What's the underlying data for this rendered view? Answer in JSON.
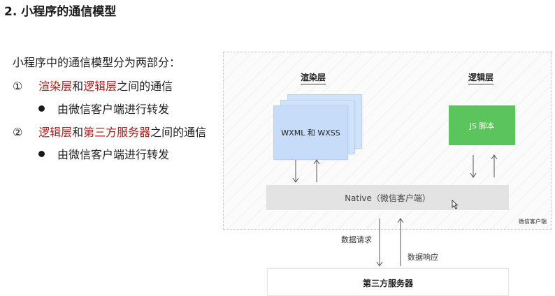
{
  "heading": "2. 小程序的通信模型",
  "intro": "小程序中的通信模型分为两部分：",
  "points": [
    {
      "num": "①",
      "parts": [
        {
          "text": "渲染层",
          "red": true
        },
        {
          "text": "和",
          "red": false
        },
        {
          "text": "逻辑层",
          "red": true
        },
        {
          "text": "之间的通信",
          "red": false
        }
      ],
      "sub": "由微信客户端进行转发"
    },
    {
      "num": "②",
      "parts": [
        {
          "text": "逻辑层",
          "red": true
        },
        {
          "text": "和",
          "red": false
        },
        {
          "text": "第三方服务器",
          "red": true
        },
        {
          "text": "之间的通信",
          "red": false
        }
      ],
      "sub": "由微信客户端进行转发"
    }
  ],
  "diagram": {
    "render_layer": "渲染层",
    "logic_layer": "逻辑层",
    "wxml_box": "WXML 和 WXSS",
    "js_box": "JS 脚本",
    "native": "Native（微信客户端）",
    "container_label": "微信客户端",
    "request": "数据请求",
    "response": "数据响应",
    "server": "第三方服务器"
  },
  "colors": {
    "accent_red": "#b3201c",
    "page_blue": "#c6dcf8",
    "js_green": "#5cc45c",
    "native_gray": "#e3e3e3"
  }
}
